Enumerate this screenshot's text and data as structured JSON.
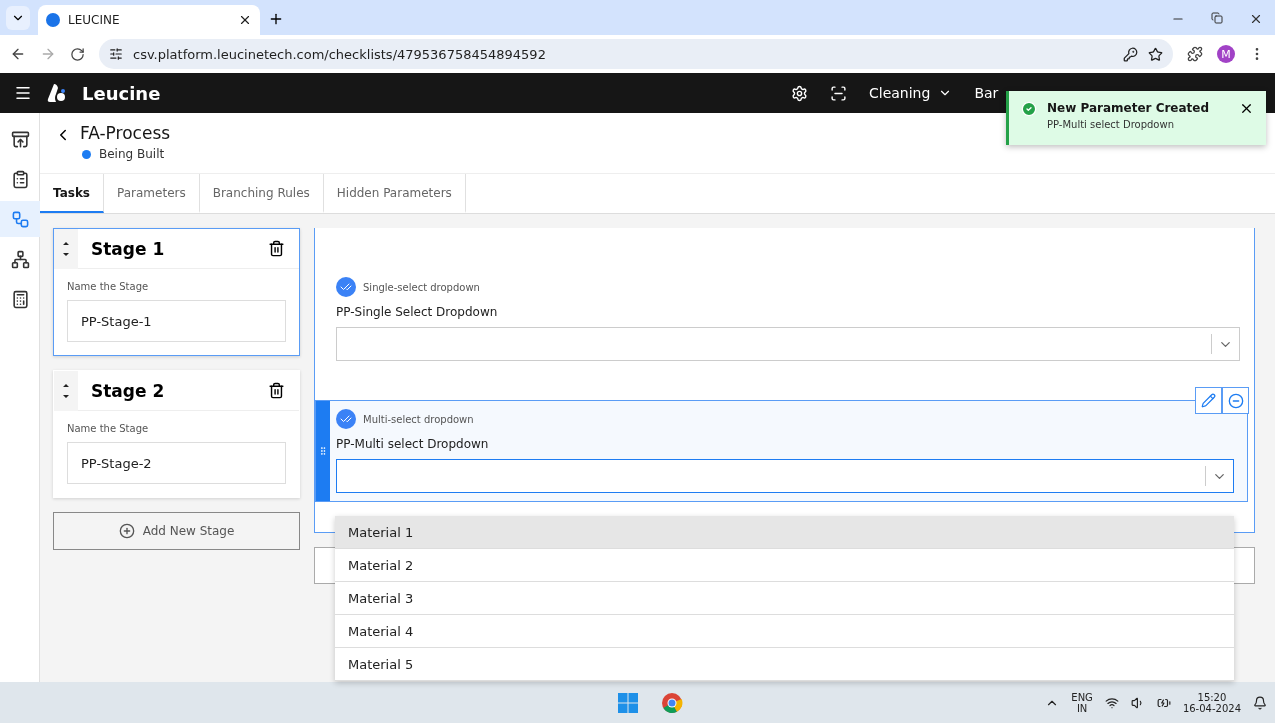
{
  "browser": {
    "tab_title": "LEUCINE",
    "url": "csv.platform.leucinetech.com/checklists/479536758454894592",
    "profile_initial": "M"
  },
  "header": {
    "brand": "Leucine",
    "facility": "Cleaning",
    "nav_cut": "Bar"
  },
  "toast": {
    "title": "New Parameter Created",
    "message": "PP-Multi select Dropdown"
  },
  "sidebar": {
    "items": [
      {
        "kind": "inbox",
        "selected": false
      },
      {
        "kind": "checklist",
        "selected": false
      },
      {
        "kind": "flow",
        "selected": true
      },
      {
        "kind": "hierarchy",
        "selected": false
      },
      {
        "kind": "report",
        "selected": false
      }
    ]
  },
  "process": {
    "title": "FA-Process",
    "status": "Being Built"
  },
  "tabs": [
    {
      "label": "Tasks",
      "selected": true
    },
    {
      "label": "Parameters",
      "selected": false
    },
    {
      "label": "Branching Rules",
      "selected": false
    },
    {
      "label": "Hidden Parameters",
      "selected": false
    }
  ],
  "stages": [
    {
      "title": "Stage 1",
      "field_label": "Name the Stage",
      "value": "PP-Stage-1",
      "selected": true
    },
    {
      "title": "Stage 2",
      "field_label": "Name the Stage",
      "value": "PP-Stage-2",
      "selected": false
    }
  ],
  "add_stage": "Add New Stage",
  "parameters": [
    {
      "type_label": "Single-select dropdown",
      "name": "PP-Single Select Dropdown",
      "selected": false
    },
    {
      "type_label": "Multi-select dropdown",
      "name": "PP-Multi select Dropdown",
      "selected": true
    }
  ],
  "dropdown_options": [
    {
      "label": "Material 1",
      "highlighted": true
    },
    {
      "label": "Material 2",
      "highlighted": false
    },
    {
      "label": "Material 3",
      "highlighted": false
    },
    {
      "label": "Material 4",
      "highlighted": false
    },
    {
      "label": "Material 5",
      "highlighted": false
    }
  ],
  "taskbar": {
    "language": "ENG",
    "region": "IN",
    "time": "15:20",
    "date": "16-04-2024"
  }
}
